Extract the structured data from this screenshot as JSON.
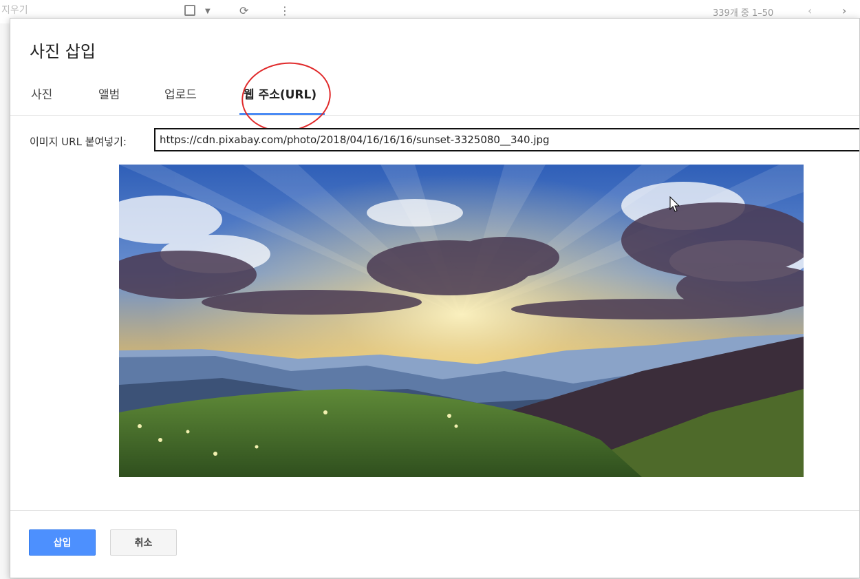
{
  "background": {
    "left_label": "지우기",
    "count_text": "339개 중 1–50"
  },
  "dialog": {
    "title": "사진 삽입",
    "tabs": [
      {
        "label": "사진",
        "active": false
      },
      {
        "label": "앨범",
        "active": false
      },
      {
        "label": "업로드",
        "active": false
      },
      {
        "label": "웹 주소(URL)",
        "active": true
      }
    ],
    "url_label": "이미지 URL 붙여넣기:",
    "url_value": "https://cdn.pixabay.com/photo/2018/04/16/16/16/sunset-3325080__340.jpg",
    "buttons": {
      "insert": "삽입",
      "cancel": "취소"
    }
  },
  "colors": {
    "accent": "#4d90fe",
    "tab_underline": "#4a8af4",
    "highlight_ring": "#e0292a"
  }
}
